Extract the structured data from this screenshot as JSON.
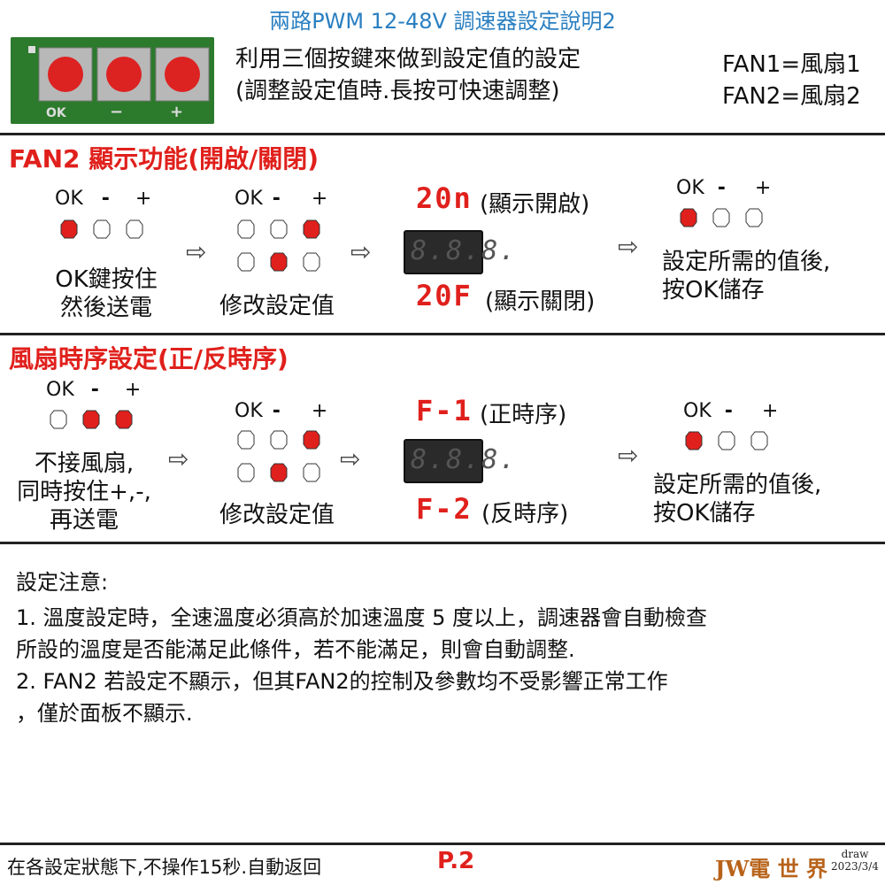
{
  "title": "兩路PWM 12-48V 調速器設定說明2",
  "board": {
    "labels": [
      "OK",
      "−",
      "+"
    ]
  },
  "intro": {
    "line1": "利用三個按鍵來做到設定值的設定",
    "line2": "(調整設定值時.長按可快速調整)",
    "fan1": "FAN1=風扇1",
    "fan2": "FAN2=風扇2"
  },
  "section1": {
    "title": "FAN2 顯示功能(開啟/關閉)",
    "buttons_header": {
      "ok": "OK",
      "minus": "-",
      "plus": "+"
    },
    "step1_caption_1": "OK鍵按住",
    "step1_caption_2": "然後送電",
    "step2_caption": "修改設定值",
    "display_on": "20n",
    "display_on_label": "(顯示開啟)",
    "display_off": "20F",
    "display_off_label": "(顯示關閉)",
    "display_digits": "8.8.8.",
    "step4_caption_1": "設定所需的值後,",
    "step4_caption_2": "按OK儲存"
  },
  "section2": {
    "title": "風扇時序設定(正/反時序)",
    "buttons_header": {
      "ok": "OK",
      "minus": "-",
      "plus": "+"
    },
    "step1_caption_1": "不接風扇,",
    "step1_caption_2": "同時按住+,-,",
    "step1_caption_3": "再送電",
    "step2_caption": "修改設定值",
    "display_f1": "F-1",
    "display_f1_label": "(正時序)",
    "display_f2": "F-2",
    "display_f2_label": "(反時序)",
    "display_digits": "8.8.8.",
    "step4_caption_1": "設定所需的值後,",
    "step4_caption_2": "按OK儲存"
  },
  "notes": {
    "heading": "設定注意:",
    "line1": "1. 溫度設定時，全速溫度必須高於加速溫度 5 度以上，調速器會自動檢查",
    "line2": "所設的溫度是否能滿足此條件，若不能滿足，則會自動調整.",
    "line3": "2. FAN2 若設定不顯示，但其FAN2的控制及參數均不受影響正常工作",
    "line4": "，僅於面板不顯示."
  },
  "footer": {
    "text": "在各設定狀態下,不操作15秒.自動返回",
    "page": "P.2",
    "brand": "JW電 世 界",
    "draw": "draw",
    "date": "2023/3/4"
  },
  "colors": {
    "active_led": "#e0201c",
    "title_blue": "#2a7fc1",
    "pcb_green": "#2c7a2c"
  }
}
